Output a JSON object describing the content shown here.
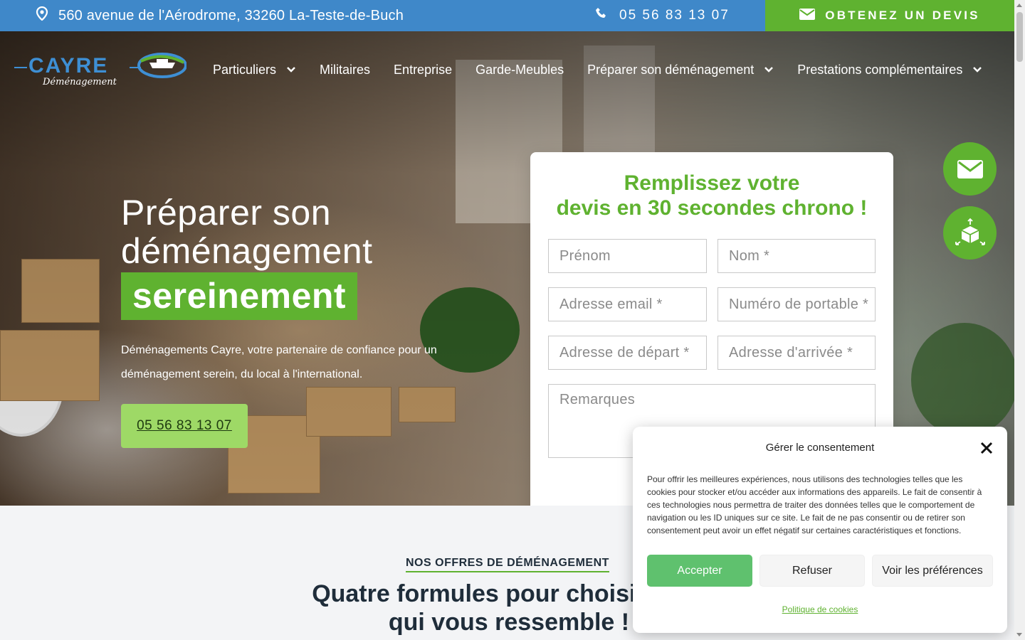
{
  "topbar": {
    "address": "560 avenue de l'Aérodrome, 33260 La-Teste-de-Buch",
    "phone": "05 56 83 13 07",
    "devis_label": "OBTENEZ UN DEVIS"
  },
  "logo": {
    "word": "CAYRE",
    "sub": "Déménagement"
  },
  "menu": [
    {
      "label": "Particuliers",
      "has_dropdown": true
    },
    {
      "label": "Militaires",
      "has_dropdown": false
    },
    {
      "label": "Entreprise",
      "has_dropdown": false
    },
    {
      "label": "Garde-Meubles",
      "has_dropdown": false
    },
    {
      "label": "Préparer son déménagement",
      "has_dropdown": true
    },
    {
      "label": "Prestations complémentaires",
      "has_dropdown": true
    }
  ],
  "hero": {
    "title_line1": "Préparer son",
    "title_line2": "déménagement",
    "highlight": "sereinement",
    "text": "Déménagements Cayre, votre partenaire de confiance pour un déménagement serein, du local à l'international.",
    "cta_phone": "05 56 83 13 07"
  },
  "form": {
    "title_line1": "Remplissez votre",
    "title_line2": "devis en 30 secondes chrono !",
    "fields": {
      "prenom": "Prénom",
      "nom": "Nom *",
      "email": "Adresse email *",
      "portable": "Numéro de portable *",
      "depart": "Adresse de départ *",
      "arrivee": "Adresse d'arrivée *",
      "remarques": "Remarques"
    }
  },
  "section": {
    "kicker": "NOS OFFRES DE DÉMÉNAGEMENT",
    "title": "Quatre formules pour choisir celle qui vous ressemble !"
  },
  "cookie": {
    "title": "Gérer le consentement",
    "body": "Pour offrir les meilleures expériences, nous utilisons des technologies telles que les cookies pour stocker et/ou accéder aux informations des appareils. Le fait de consentir à ces technologies nous permettra de traiter des données telles que le comportement de navigation ou les ID uniques sur ce site. Le fait de ne pas consentir ou de retirer son consentement peut avoir un effet négatif sur certaines caractéristiques et fonctions.",
    "accept": "Accepter",
    "refuse": "Refuser",
    "prefs": "Voir les préférences",
    "policy": "Politique de cookies"
  },
  "colors": {
    "brand_blue": "#3f88c9",
    "brand_green": "#5fb230",
    "accept_green": "#5fc16e"
  },
  "icons": {
    "topbar_address": "location-pin-icon",
    "topbar_phone": "phone-icon",
    "topbar_devis": "envelope-icon",
    "fab_mail": "envelope-icon",
    "fab_box": "box-icon"
  }
}
